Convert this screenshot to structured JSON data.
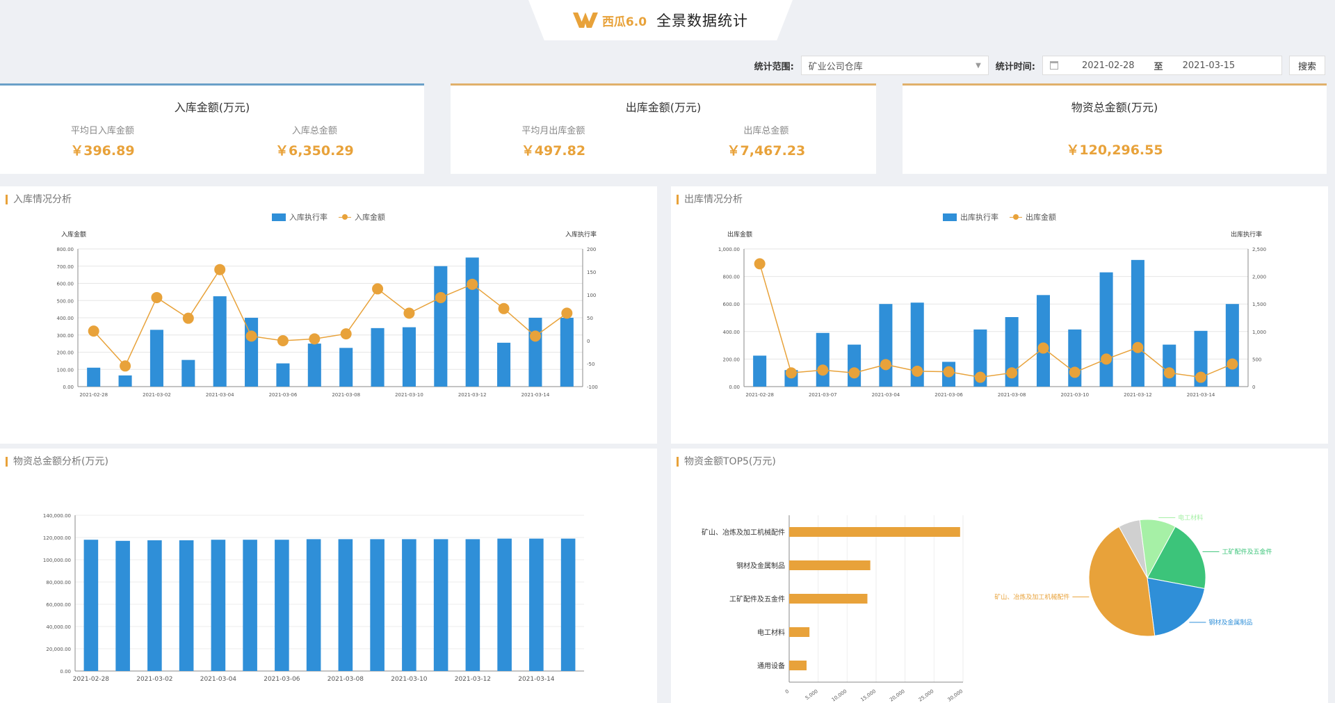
{
  "header": {
    "logo_text": "西瓜6.0",
    "title": "全景数据统计"
  },
  "filters": {
    "scope_label": "统计范围:",
    "scope_value": "矿业公司仓库",
    "time_label": "统计时间:",
    "date_start": "2021-02-28",
    "date_sep": "至",
    "date_end": "2021-03-15",
    "search_label": "搜索"
  },
  "kpis": {
    "inbound": {
      "title": "入库金额(万元)",
      "avg_label": "平均日入库金额",
      "avg_value": "￥396.89",
      "total_label": "入库总金额",
      "total_value": "￥6,350.29"
    },
    "outbound": {
      "title": "出库金额(万元)",
      "avg_label": "平均月出库金额",
      "avg_value": "￥497.82",
      "total_label": "出库总金额",
      "total_value": "￥7,467.23"
    },
    "inventory": {
      "title": "物资总金额(万元)",
      "total_value": "￥120,296.55"
    }
  },
  "panels": {
    "inbound_trend": "入库情况分析",
    "outbound_trend": "出库情况分析",
    "inventory_total": "物资总金额分析(万元)",
    "top5": "物资金额TOP5(万元)"
  },
  "chart_data": [
    {
      "id": "inbound",
      "type": "bar",
      "legend": [
        "入库执行率",
        "入库金额"
      ],
      "left_axis_label": "入库金额",
      "right_axis_label": "入库执行率",
      "x_labels": [
        "2021-02-28",
        "2021-03-02",
        "2021-03-04",
        "2021-03-06",
        "2021-03-08",
        "2021-03-10",
        "2021-03-12",
        "2021-03-14"
      ],
      "y_ticks": [
        "0.00",
        "100.00",
        "200.00",
        "300.00",
        "400.00",
        "500.00",
        "600.00",
        "700.00",
        "800.00"
      ],
      "y2_ticks": [
        "-100",
        "-50",
        "0",
        "50",
        "100",
        "150",
        "200"
      ],
      "bars": [
        110,
        65,
        330,
        155,
        525,
        400,
        135,
        250,
        225,
        340,
        345,
        700,
        750,
        255,
        400,
        400
      ],
      "line": [
        21,
        -55,
        94,
        49,
        155,
        10,
        0,
        4,
        15,
        113,
        60,
        94,
        123,
        70,
        10,
        60
      ],
      "ylim": [
        0,
        800
      ],
      "y2lim": [
        -100,
        200
      ]
    },
    {
      "id": "outbound",
      "type": "bar",
      "legend": [
        "出库执行率",
        "出库金额"
      ],
      "left_axis_label": "出库金额",
      "right_axis_label": "出库执行率",
      "x_labels": [
        "2021-02-28",
        "2021-03-07",
        "2021-03-04",
        "2021-03-06",
        "2021-03-08",
        "2021-03-10",
        "2021-03-12",
        "2021-03-14"
      ],
      "y_ticks": [
        "0.00",
        "200.00",
        "400.00",
        "600.00",
        "800.00",
        "1,000.00"
      ],
      "y2_ticks": [
        "0",
        "500",
        "1,000",
        "1,500",
        "2,000",
        "2,500"
      ],
      "bars": [
        225,
        120,
        390,
        305,
        600,
        610,
        180,
        415,
        505,
        665,
        415,
        830,
        920,
        305,
        405,
        600
      ],
      "line": [
        2230,
        250,
        300,
        250,
        400,
        280,
        270,
        170,
        250,
        700,
        260,
        500,
        710,
        250,
        170,
        410
      ],
      "ylim": [
        0,
        1000
      ],
      "y2lim": [
        0,
        2500
      ]
    },
    {
      "id": "inventory",
      "type": "bar",
      "x_labels": [
        "2021-02-28",
        "2021-03-02",
        "2021-03-04",
        "2021-03-06",
        "2021-03-08",
        "2021-03-10",
        "2021-03-12",
        "2021-03-14"
      ],
      "y_ticks": [
        "0.00",
        "20,000.00",
        "40,000.00",
        "60,000.00",
        "80,000.00",
        "100,000.00",
        "120,000.00",
        "140,000.00"
      ],
      "bars": [
        118000,
        117000,
        117500,
        117500,
        118000,
        118000,
        118000,
        118500,
        118500,
        118500,
        118500,
        118500,
        118500,
        119000,
        119000,
        119000
      ],
      "ylim": [
        0,
        140000
      ]
    },
    {
      "id": "top5_bar",
      "type": "bar",
      "orientation": "horizontal",
      "categories": [
        "矿山、冶炼及加工机械配件",
        "钢材及金属制品",
        "工矿配件及五金件",
        "电工材料",
        "通用设备"
      ],
      "values": [
        29500,
        14000,
        13500,
        3500,
        3000
      ],
      "x_ticks": [
        "0",
        "5,000",
        "10,000",
        "15,000",
        "20,000",
        "25,000",
        "30,000"
      ],
      "xlim": [
        0,
        30000
      ]
    },
    {
      "id": "top5_pie",
      "type": "pie",
      "slices": [
        {
          "name": "矿山、冶炼及加工机械配件",
          "value": 0.44,
          "color": "#e8a23a"
        },
        {
          "name": "钢材及金属制品",
          "value": 0.2,
          "color": "#2f8fd8"
        },
        {
          "name": "工矿配件及五金件",
          "value": 0.2,
          "color": "#3cc47a"
        },
        {
          "name": "电工材料",
          "value": 0.1,
          "color": "#a6f0a6"
        },
        {
          "name": "通用设备",
          "value": 0.06,
          "color": "#d0d0d0"
        }
      ],
      "labels_shown": [
        "矿山、冶炼及加工机械配件",
        "工矿配件及五金件",
        "钢材及金属制品",
        "电工材料"
      ]
    }
  ],
  "colors": {
    "accent": "#e8a23a",
    "bar": "#2f8fd8"
  }
}
